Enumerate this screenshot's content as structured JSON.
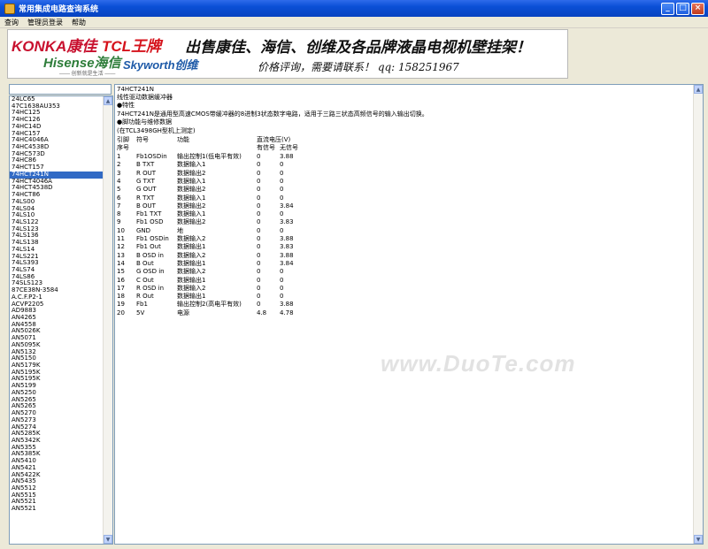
{
  "window": {
    "title": "常用集成电路查询系统"
  },
  "menu": [
    "查询",
    "管理员登录",
    "帮助"
  ],
  "banner": {
    "konka": "KONKA康佳",
    "tcl": "TCL王牌",
    "hisense": "Hisense海信",
    "hisense_sub": "—— 创新就是生活 ——",
    "skyworth": "Skyworth创维",
    "slogan": "出售康佳、海信、创维及各品牌液晶电视机壁挂架！",
    "contact": "价格评询，需要请联系！ qq: 158251967"
  },
  "search": {
    "value": ""
  },
  "chips": [
    "24LC65",
    "47C1638AU353",
    "74HC125",
    "74HC126",
    "74HC14D",
    "74HC157",
    "74HC4046A",
    "74HC4538D",
    "74HC573D",
    "74HC86",
    "74HCT157",
    "74HCT241N",
    "74HCT4046A",
    "74HCT4538D",
    "74HCT86",
    "74LS00",
    "74LS04",
    "74LS10",
    "74LS122",
    "74LS123",
    "74LS136",
    "74LS138",
    "74LS14",
    "74LS221",
    "74LS393",
    "74LS74",
    "74LS86",
    "74SLS123",
    "87CE38N-3584",
    "A.C.F.P2-1",
    "ACVP2205",
    "AD9883",
    "AN4265",
    "AN4558",
    "AN5026K",
    "AN5071",
    "AN5095K",
    "AN5132",
    "AN5150",
    "AN5179K",
    "AN5195K",
    "AN5195K",
    "AN5199",
    "AN5250",
    "AN5265",
    "AN5265",
    "AN5270",
    "AN5273",
    "AN5274",
    "AN5285K",
    "AN5342K",
    "AN5355",
    "AN5385K",
    "AN5410",
    "AN5421",
    "AN5422K",
    "AN5435",
    "AN5512",
    "AN5515",
    "AN5521",
    "AN5521"
  ],
  "selected_chip_index": 11,
  "detail": {
    "part": "74HCT241N",
    "subtitle": "线性驱动数据缓冲器",
    "feature_heading": "●特性",
    "feature_text": "74HCT241N是通用型高速CMOS带缓冲器的8进制3状态数字电路，适用于三路三状态高频信号的输入输出切换。",
    "pin_heading": "●脚功能与维修数据",
    "note": "(在TCL3498GH型机上测定)",
    "headers": {
      "pin": "引脚",
      "symbol": "符号",
      "function": "功能",
      "voltage": "直流电压(V)"
    },
    "subheaders": {
      "seq": "序号",
      "with_signal": "有信号",
      "without_signal": "无信号"
    },
    "rows": [
      [
        "1",
        "Fb1OSDin",
        "输出控制1(低电平有效)",
        "0",
        "3.88"
      ],
      [
        "2",
        "B TXT",
        "数据输入1",
        "0",
        "0"
      ],
      [
        "3",
        "R OUT",
        "数据输出2",
        "0",
        "0"
      ],
      [
        "4",
        "G TXT",
        "数据输入1",
        "0",
        "0"
      ],
      [
        "5",
        "G OUT",
        "数据输出2",
        "0",
        "0"
      ],
      [
        "6",
        "R TXT",
        "数据输入1",
        "0",
        "0"
      ],
      [
        "7",
        "B OUT",
        "数据输出2",
        "0",
        "3.84"
      ],
      [
        "8",
        "Fb1 TXT",
        "数据输入1",
        "0",
        "0"
      ],
      [
        "9",
        "Fb1 OSD",
        "数据输出2",
        "0",
        "3.83"
      ],
      [
        "10",
        "GND",
        "地",
        "0",
        "0"
      ],
      [
        "11",
        "Fb1 OSDin",
        "数据输入2",
        "0",
        "3.88"
      ],
      [
        "12",
        "Fb1 Out",
        "数据输出1",
        "0",
        "3.83"
      ],
      [
        "13",
        "B OSD in",
        "数据输入2",
        "0",
        "3.88"
      ],
      [
        "14",
        "B Out",
        "数据输出1",
        "0",
        "3.84"
      ],
      [
        "15",
        "G OSD in",
        "数据输入2",
        "0",
        "0"
      ],
      [
        "16",
        "C Out",
        "数据输出1",
        "0",
        "0"
      ],
      [
        "17",
        "R OSD in",
        "数据输入2",
        "0",
        "0"
      ],
      [
        "18",
        "R Out",
        "数据输出1",
        "0",
        "0"
      ],
      [
        "19",
        "Fb1",
        "输出控制2(高电平有效)",
        "0",
        "3.88"
      ],
      [
        "20",
        "5V",
        "电源",
        "4.8",
        "4.78"
      ]
    ]
  },
  "watermark": "www.DuoTe.com"
}
